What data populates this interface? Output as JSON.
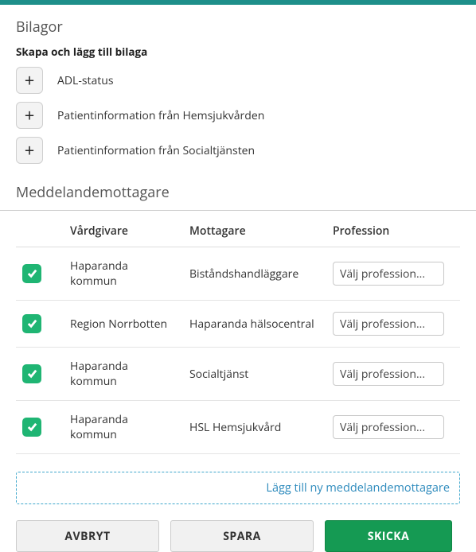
{
  "bilagor": {
    "title": "Bilagor",
    "subtitle": "Skapa och lägg till bilaga",
    "items": [
      {
        "label": "ADL-status"
      },
      {
        "label": "Patientinformation från Hemsjukvården"
      },
      {
        "label": "Patientinformation från Socialtjänsten"
      }
    ]
  },
  "recipients": {
    "title": "Meddelandemottagare",
    "headers": {
      "provider": "Vårdgivare",
      "receiver": "Mottagare",
      "profession": "Profession"
    },
    "rows": [
      {
        "checked": true,
        "provider": "Haparanda kommun",
        "receiver": "Biståndshandläggare",
        "profession": "Välj profession..."
      },
      {
        "checked": true,
        "provider": "Region Norrbotten",
        "receiver": "Haparanda hälsocentral",
        "profession": "Välj profession..."
      },
      {
        "checked": true,
        "provider": "Haparanda kommun",
        "receiver": "Socialtjänst",
        "profession": "Välj profession..."
      },
      {
        "checked": true,
        "provider": "Haparanda kommun",
        "receiver": "HSL Hemsjukvård",
        "profession": "Välj profession..."
      }
    ],
    "add_label": "Lägg till ny meddelandemottagare"
  },
  "buttons": {
    "cancel": "AVBRYT",
    "save": "SPARA",
    "send": "SKICKA"
  }
}
